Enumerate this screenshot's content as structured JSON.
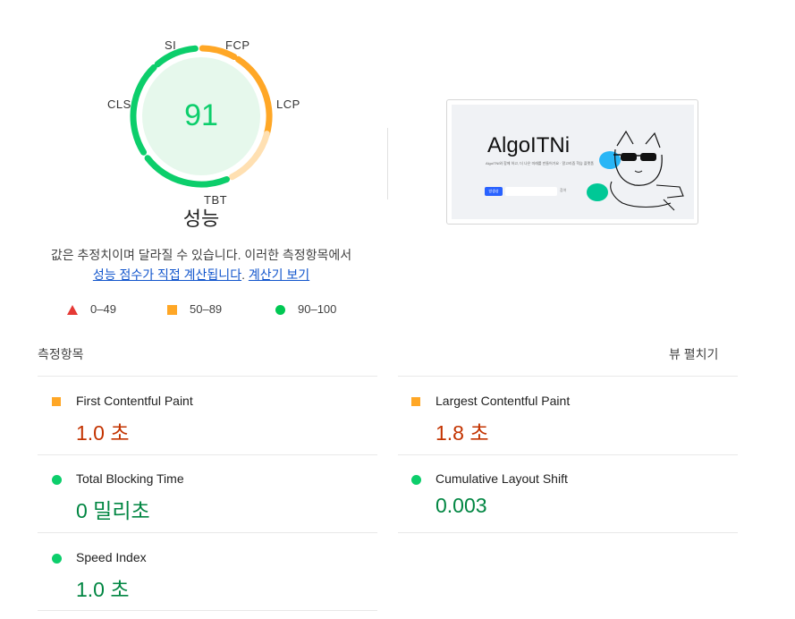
{
  "gauge": {
    "score": "91",
    "labels": {
      "si": "SI",
      "fcp": "FCP",
      "lcp": "LCP",
      "cls": "CLS",
      "tbt": "TBT"
    },
    "colors": {
      "pass": "#0cce6b",
      "average": "#ffa726",
      "average_light": "#ffe0b2",
      "fill": "#e6f8ec",
      "score_text": "#0cce6b"
    }
  },
  "score_title": "성능",
  "note": {
    "text": "값은 추정치이며 달라질 수 있습니다. 이러한 측정항목에서",
    "link1": "성능 점수가 직접 계산됩니다",
    "sep": ". ",
    "link2": "계산기 보기"
  },
  "legend": {
    "fail": "0–49",
    "average": "50–89",
    "pass": "90–100"
  },
  "screenshot": {
    "title": "AlgoITNi",
    "subtitle": "AlgoITNi와 함께 하고, 더 나은 미래를 만들어가요 · 알고리즘 학습 플랫폼",
    "button": "방생성",
    "link": "참여"
  },
  "metrics": {
    "heading": "측정항목",
    "expand": "뷰 펼치기",
    "fcp": {
      "label": "First Contentful Paint",
      "value": "1.0 초"
    },
    "lcp": {
      "label": "Largest Contentful Paint",
      "value": "1.8 초"
    },
    "tbt": {
      "label": "Total Blocking Time",
      "value": "0 밀리초"
    },
    "cls": {
      "label": "Cumulative Layout Shift",
      "value": "0.003"
    },
    "si": {
      "label": "Speed Index",
      "value": "1.0 초"
    }
  }
}
